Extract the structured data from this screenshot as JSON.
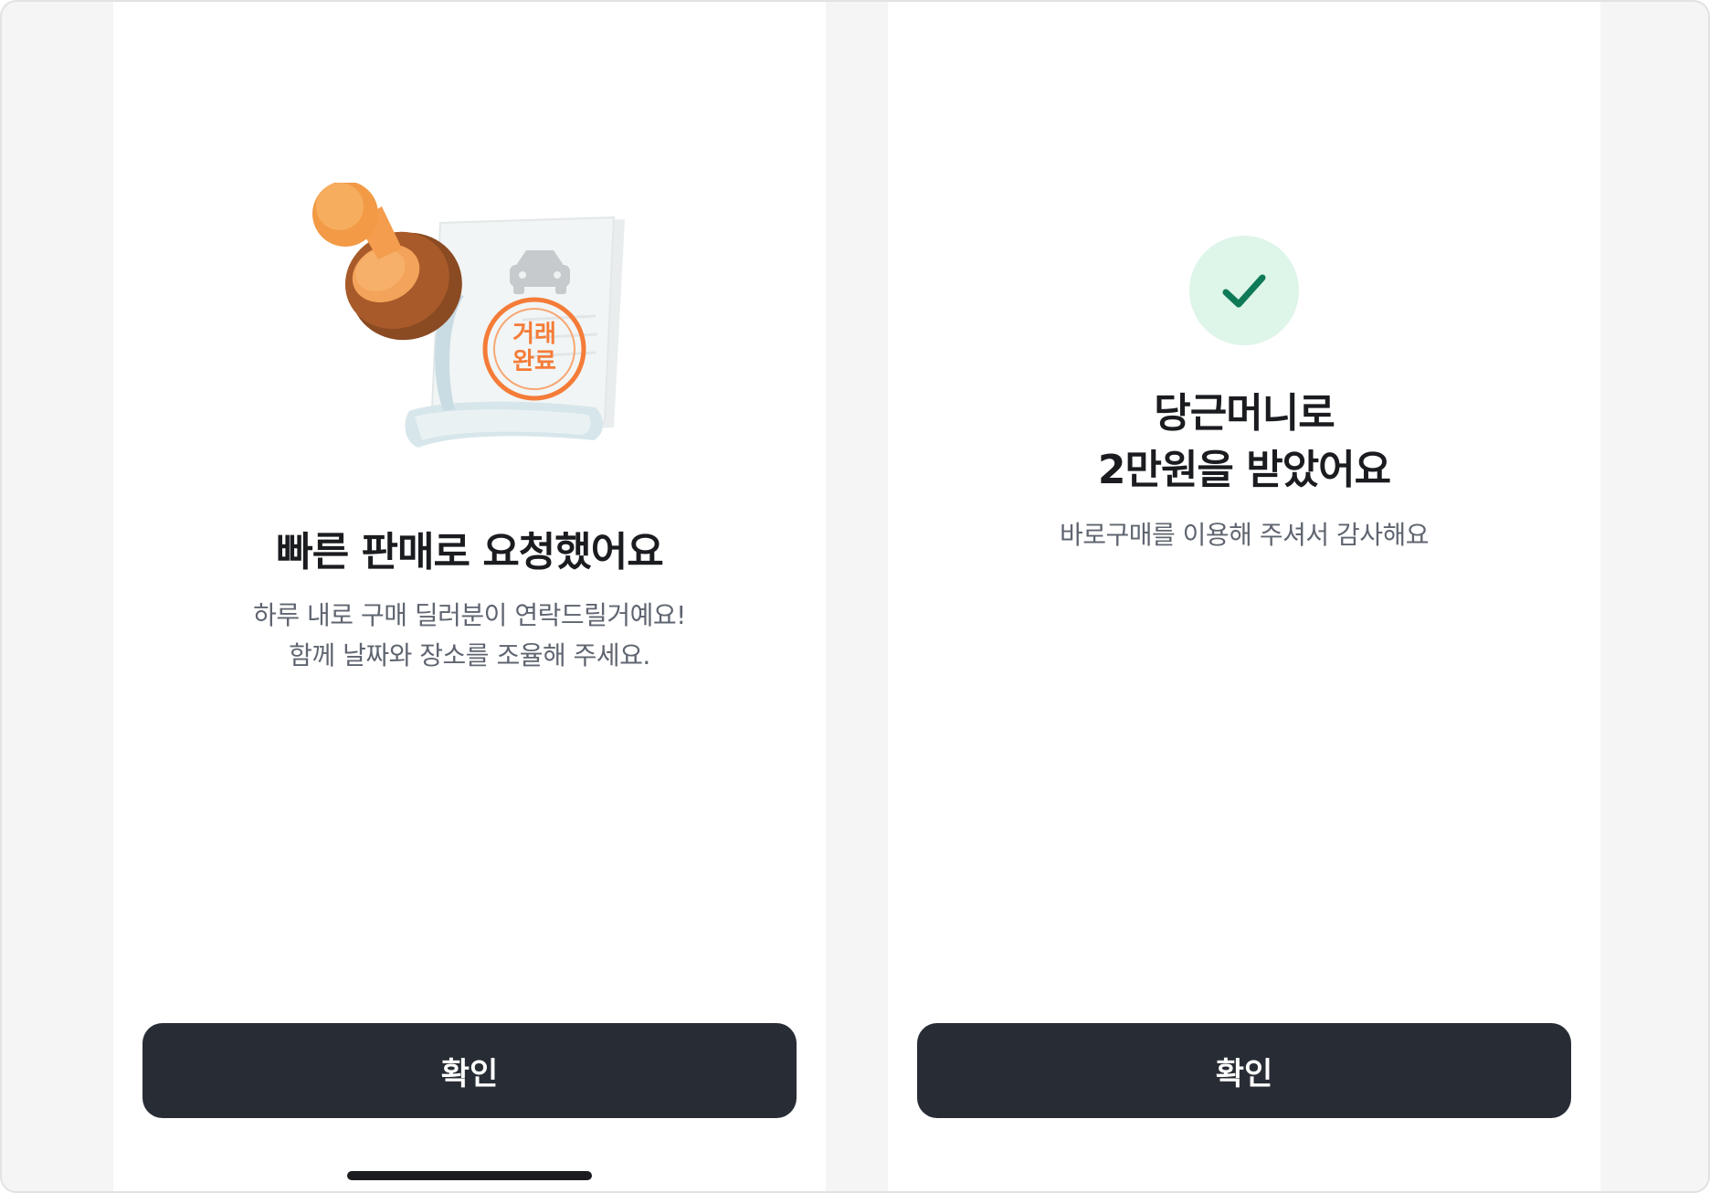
{
  "left_screen": {
    "stamp_text_line1": "거래",
    "stamp_text_line2": "완료",
    "title": "빠른 판매로 요청했어요",
    "description_line1": "하루 내로 구매 딜러분이 연락드릴거예요!",
    "description_line2": "함께 날짜와 장소를 조율해 주세요.",
    "confirm_label": "확인",
    "illustration_icon": "stamp-document-illustration"
  },
  "right_screen": {
    "status_icon": "check-icon",
    "title_line1": "당근머니로",
    "title_line2": "2만원을 받았어요",
    "description": "바로구매를 이용해 주셔서 감사해요",
    "confirm_label": "확인"
  },
  "colors": {
    "button_bg": "#282d35",
    "accent_orange": "#f47c38",
    "success_green": "#0e7a58",
    "success_bg": "#def5e9"
  }
}
